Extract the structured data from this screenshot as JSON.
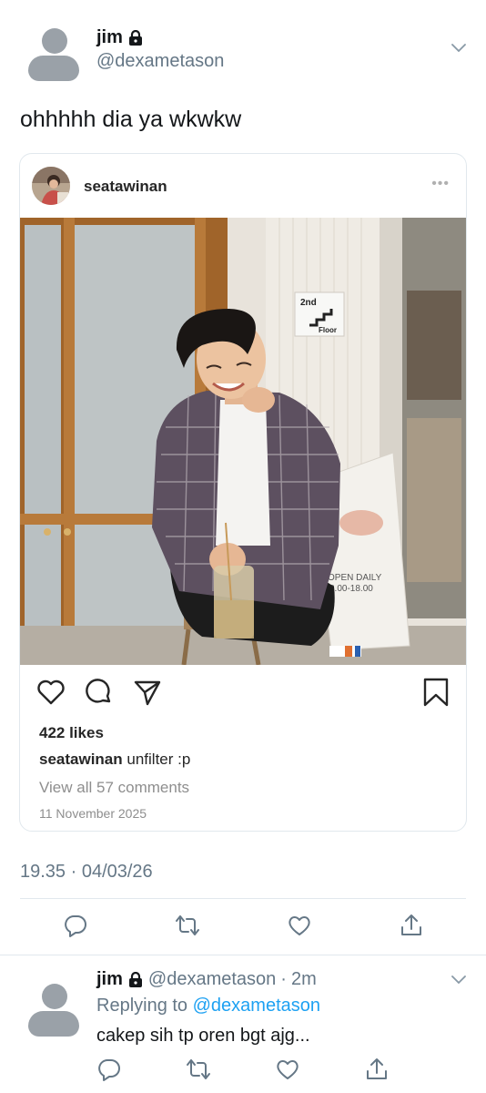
{
  "tweet": {
    "display_name": "jim",
    "handle": "@dexametason",
    "text": "ohhhhh dia ya wkwkw",
    "timestamp": "19.35 · 04/03/26"
  },
  "instagram_embed": {
    "username": "seatawinan",
    "more_label": "•••",
    "likes": "422 likes",
    "caption_user": "seatawinan",
    "caption_text": "unfilter :p",
    "view_comments": "View all 57 comments",
    "date": "11 November 2025",
    "photo_signs": {
      "floor_sign_line1": "2nd",
      "floor_sign_line2": "Floor",
      "board_line1": "OPEN DAILY",
      "board_line2": "8.00-18.00"
    }
  },
  "reply": {
    "display_name": "jim",
    "handle": "@dexametason",
    "separator": "·",
    "age": "2m",
    "replying_prefix": "Replying to",
    "replying_to": "@dexametason",
    "text": "cakep sih tp oren bgt ajg..."
  },
  "colors": {
    "link_blue": "#1da1f2",
    "muted_gray": "#657786",
    "divider": "#e1e8ed"
  }
}
